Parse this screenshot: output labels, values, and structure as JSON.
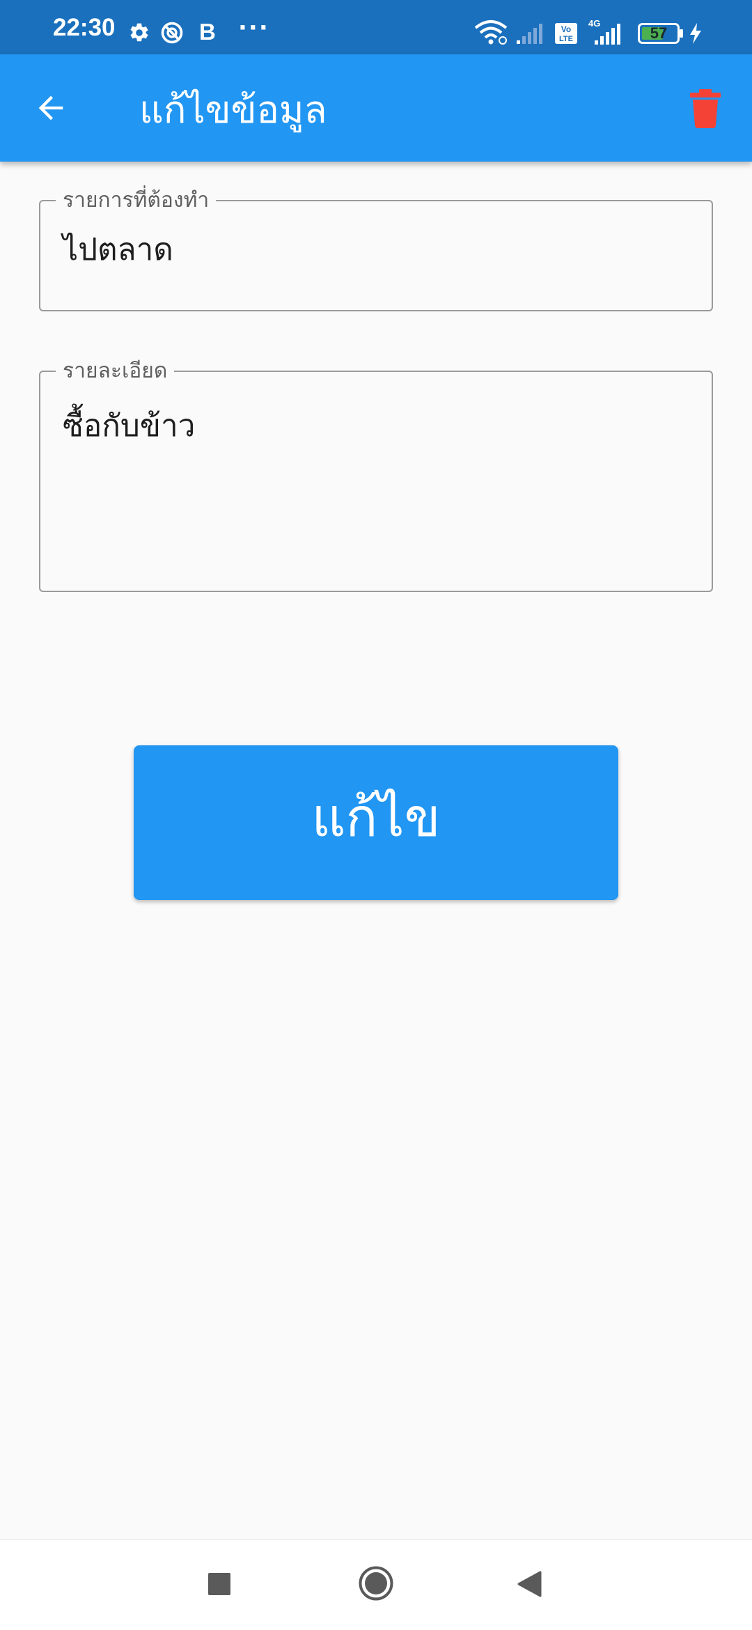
{
  "status_bar": {
    "time": "22:30",
    "letter_icon": "B",
    "more_glyph": "···",
    "battery_level": "57",
    "icons": [
      "gear-icon",
      "dnd-icon",
      "bold-b-icon",
      "more-icon",
      "wifi-icon",
      "signal-1-icon",
      "volte-icon",
      "signal-4g-icon",
      "battery-icon",
      "charging-icon"
    ],
    "background_color": "#1a70bd"
  },
  "app_bar": {
    "title": "แก้ไขข้อมูล",
    "back_icon": "arrow-back-icon",
    "delete_icon": "trash-icon",
    "background_color": "#2196f3",
    "delete_color": "#f44336"
  },
  "form": {
    "title_field": {
      "label": "รายการที่ต้องทำ",
      "value": "ไปตลาด"
    },
    "detail_field": {
      "label": "รายละเอียด",
      "value": "ซื้อกับข้าว"
    }
  },
  "edit_button": {
    "label": "แก้ไข",
    "color": "#2196f3"
  },
  "nav_bar": {
    "recents_icon": "square-icon",
    "home_icon": "circle-icon",
    "back_icon": "triangle-back-icon"
  }
}
